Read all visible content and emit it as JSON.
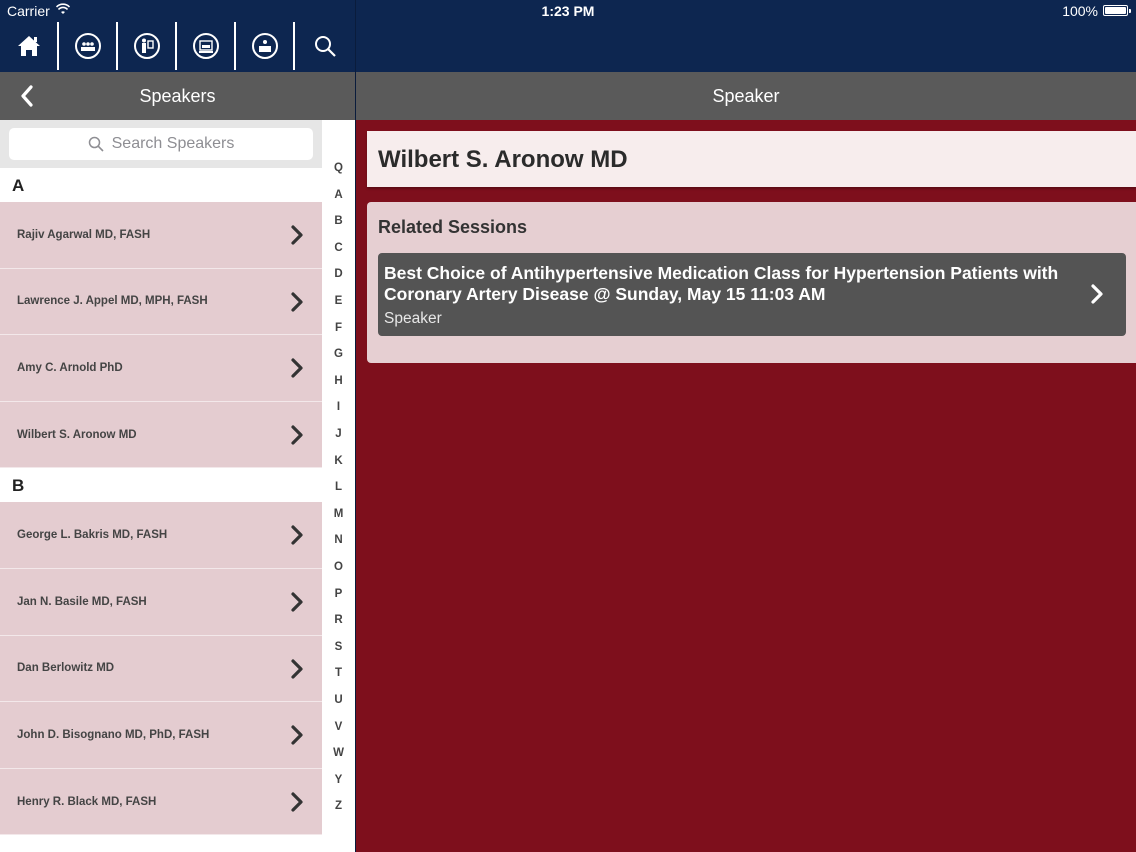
{
  "status_bar": {
    "carrier": "Carrier",
    "time": "1:23 PM",
    "battery": "100%"
  },
  "top_nav": {
    "icons": [
      "home-icon",
      "speakers-icon",
      "presenter-icon",
      "schedule-icon",
      "exhibitors-icon",
      "search-icon"
    ]
  },
  "left_nav": {
    "title": "Speakers"
  },
  "right_nav": {
    "title": "Speaker"
  },
  "search": {
    "placeholder": "Search Speakers"
  },
  "sections": [
    {
      "letter": "A",
      "items": [
        "Rajiv Agarwal MD, FASH",
        "Lawrence J. Appel MD, MPH, FASH",
        "Amy C. Arnold PhD",
        "Wilbert S. Aronow MD"
      ]
    },
    {
      "letter": "B",
      "items": [
        "George L. Bakris MD, FASH",
        "Jan N. Basile MD, FASH",
        "Dan Berlowitz MD",
        "John D. Bisognano MD, PhD, FASH",
        "Henry R. Black MD, FASH"
      ]
    }
  ],
  "index_letters": [
    "Q",
    "A",
    "B",
    "C",
    "D",
    "E",
    "F",
    "G",
    "H",
    "I",
    "J",
    "K",
    "L",
    "M",
    "N",
    "O",
    "P",
    "R",
    "S",
    "T",
    "U",
    "V",
    "W",
    "Y",
    "Z"
  ],
  "speaker": {
    "name": "Wilbert S. Aronow MD",
    "related_heading": "Related Sessions",
    "sessions": [
      {
        "title": "Best Choice of Antihypertensive Medication Class for Hypertension Patients with Coronary Artery Disease @ Sunday, May 15 11:03 AM",
        "role": "Speaker"
      }
    ]
  },
  "colors": {
    "header_navy": "#0d2650",
    "navbar_gray": "#5a5a5a",
    "list_row": "#e4ccd0",
    "background_red": "#7e0f1c"
  }
}
